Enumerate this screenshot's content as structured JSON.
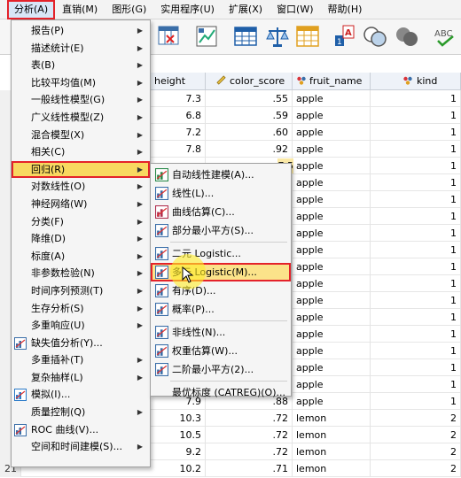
{
  "menubar": [
    "分析(A)",
    "直销(M)",
    "图形(G)",
    "实用程序(U)",
    "扩展(X)",
    "窗口(W)",
    "帮助(H)"
  ],
  "columns": {
    "height": "height",
    "color_score": "color_score",
    "fruit_name": "fruit_name",
    "kind": "kind"
  },
  "rows": [
    {
      "n": "",
      "height": "7.3",
      "color": ".55",
      "fruit": "apple",
      "kind": "1"
    },
    {
      "n": "",
      "height": "6.8",
      "color": ".59",
      "fruit": "apple",
      "kind": "1"
    },
    {
      "n": "",
      "height": "7.2",
      "color": ".60",
      "fruit": "apple",
      "kind": "1"
    },
    {
      "n": "",
      "height": "7.8",
      "color": ".92",
      "fruit": "apple",
      "kind": "1"
    },
    {
      "n": "",
      "height": "",
      "color": "",
      "fruit": "apple",
      "kind": "1"
    },
    {
      "n": "",
      "height": "",
      "color": "",
      "fruit": "apple",
      "kind": "1"
    },
    {
      "n": "",
      "height": "",
      "color": "",
      "fruit": "apple",
      "kind": "1"
    },
    {
      "n": "",
      "height": "",
      "color": "",
      "fruit": "apple",
      "kind": "1"
    },
    {
      "n": "",
      "height": "",
      "color": "",
      "fruit": "apple",
      "kind": "1"
    },
    {
      "n": "",
      "height": "",
      "color": "",
      "fruit": "apple",
      "kind": "1"
    },
    {
      "n": "",
      "height": "",
      "color": "",
      "fruit": "apple",
      "kind": "1"
    },
    {
      "n": "",
      "height": "",
      "color": "",
      "fruit": "apple",
      "kind": "1"
    },
    {
      "n": "",
      "height": "",
      "color": "",
      "fruit": "apple",
      "kind": "1"
    },
    {
      "n": "",
      "height": "",
      "color": "",
      "fruit": "apple",
      "kind": "1"
    },
    {
      "n": "",
      "height": "",
      "color": "",
      "fruit": "apple",
      "kind": "1"
    },
    {
      "n": "",
      "height": "",
      "color": "",
      "fruit": "apple",
      "kind": "1"
    },
    {
      "n": "",
      "height": "",
      "color": "",
      "fruit": "apple",
      "kind": "1"
    },
    {
      "n": "",
      "height": "",
      "color": "",
      "fruit": "apple",
      "kind": "1"
    },
    {
      "n": "",
      "height": "7.9",
      "color": ".88",
      "fruit": "apple",
      "kind": "1"
    },
    {
      "n": "",
      "height": "10.3",
      "color": ".72",
      "fruit": "lemon",
      "kind": "2"
    },
    {
      "n": "2",
      "height": "10.5",
      "color": ".72",
      "fruit": "lemon",
      "kind": "2"
    },
    {
      "n": "2",
      "height": "9.2",
      "color": ".72",
      "fruit": "lemon",
      "kind": "2"
    },
    {
      "n": "21",
      "height": "10.2",
      "color": ".71",
      "fruit": "lemon",
      "kind": "2"
    }
  ],
  "partial_values": [
    "7.5"
  ],
  "main_menu": [
    {
      "label": "报告(P)",
      "arrow": true
    },
    {
      "label": "描述统计(E)",
      "arrow": true
    },
    {
      "label": "表(B)",
      "arrow": true
    },
    {
      "label": "比较平均值(M)",
      "arrow": true
    },
    {
      "label": "一般线性模型(G)",
      "arrow": true
    },
    {
      "label": "广义线性模型(Z)",
      "arrow": true
    },
    {
      "label": "混合模型(X)",
      "arrow": true
    },
    {
      "label": "相关(C)",
      "arrow": true
    },
    {
      "label": "回归(R)",
      "arrow": true,
      "highlight": true
    },
    {
      "label": "对数线性(O)",
      "arrow": true
    },
    {
      "label": "神经网络(W)",
      "arrow": true
    },
    {
      "label": "分类(F)",
      "arrow": true
    },
    {
      "label": "降维(D)",
      "arrow": true
    },
    {
      "label": "标度(A)",
      "arrow": true
    },
    {
      "label": "非参数检验(N)",
      "arrow": true
    },
    {
      "label": "时间序列预测(T)",
      "arrow": true
    },
    {
      "label": "生存分析(S)",
      "arrow": true
    },
    {
      "label": "多重响应(U)",
      "arrow": true
    },
    {
      "label": "缺失值分析(Y)...",
      "arrow": false,
      "icon": "missing-values-icon"
    },
    {
      "label": "多重插补(T)",
      "arrow": true
    },
    {
      "label": "复杂抽样(L)",
      "arrow": true
    },
    {
      "label": "模拟(I)...",
      "arrow": false,
      "icon": "simulation-icon"
    },
    {
      "label": "质量控制(Q)",
      "arrow": true
    },
    {
      "label": "ROC 曲线(V)...",
      "arrow": false,
      "icon": "roc-curve-icon"
    },
    {
      "label": "空间和时间建模(S)...",
      "arrow": true
    }
  ],
  "regression_menu": [
    {
      "label": "自动线性建模(A)...",
      "icon": "auto-linear-icon"
    },
    {
      "label": "线性(L)...",
      "icon": "linear-icon"
    },
    {
      "label": "曲线估算(C)...",
      "icon": "curve-estimation-icon"
    },
    {
      "label": "部分最小平方(S)...",
      "icon": "partial-least-squares-icon",
      "sep_after": true
    },
    {
      "label": "二元 Logistic...",
      "icon": "binary-logistic-icon"
    },
    {
      "label": "多元 Logistic(M)...",
      "icon": "multinomial-logistic-icon",
      "highlight": true
    },
    {
      "label": "有序(D)...",
      "icon": "ordinal-icon"
    },
    {
      "label": "概率(P)...",
      "icon": "probit-icon",
      "sep_after": true
    },
    {
      "label": "非线性(N)...",
      "icon": "nonlinear-icon"
    },
    {
      "label": "权重估算(W)...",
      "icon": "weight-estimation-icon"
    },
    {
      "label": "二阶最小平方(2)...",
      "icon": "two-stage-least-squares-icon",
      "sep_after": true
    },
    {
      "label": "最优标度 (CATREG)(O)...",
      "icon": ""
    }
  ]
}
